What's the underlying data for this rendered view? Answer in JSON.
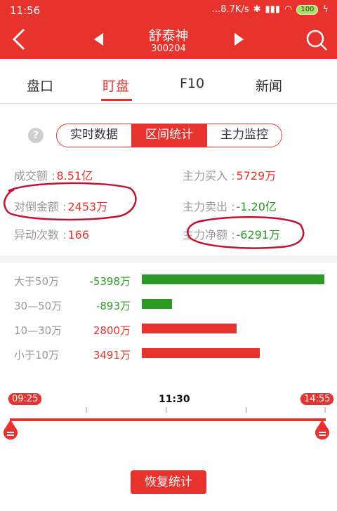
{
  "status_bar": {
    "time": "11:56",
    "network_speed": "...8.7K/s",
    "battery": "100"
  },
  "header": {
    "stock_name": "舒泰神",
    "stock_code": "300204"
  },
  "tabs": [
    {
      "label": "盘口",
      "active": false
    },
    {
      "label": "盯盘",
      "active": true
    },
    {
      "label": "F10",
      "active": false
    },
    {
      "label": "新闻",
      "active": false
    }
  ],
  "segments": [
    {
      "label": "实时数据",
      "active": false
    },
    {
      "label": "区间统计",
      "active": true
    },
    {
      "label": "主力监控",
      "active": false
    }
  ],
  "stats": {
    "turnover": {
      "label": "成交额 :",
      "value": "8.51亿"
    },
    "main_buy": {
      "label": "主力买入 :",
      "value": "5729万"
    },
    "opposite_amount": {
      "label": "对倒金额 :",
      "value": "2453万"
    },
    "main_sell": {
      "label": "主力卖出 :",
      "value": "-1.20亿"
    },
    "abnormal_count": {
      "label": "异动次数 :",
      "value": "166"
    },
    "main_net": {
      "label": "主力净额 :",
      "value": "-6291万"
    }
  },
  "distribution": [
    {
      "label": "大于50万",
      "value": "-5398万",
      "amount": -5398,
      "color": "#2a9a25"
    },
    {
      "label": "30—50万",
      "value": "-893万",
      "amount": -893,
      "color": "#2a9a25"
    },
    {
      "label": "10—30万",
      "value": "2800万",
      "amount": 2800,
      "color": "#e8322d"
    },
    {
      "label": "小于10万",
      "value": "3491万",
      "amount": 3491,
      "color": "#e8322d"
    }
  ],
  "timeline": {
    "start": "09:25",
    "mid": "11:30",
    "end": "14:55"
  },
  "restore_button": "恢复统计",
  "colors": {
    "accent": "#e8322d",
    "negative": "#2a9a25"
  }
}
